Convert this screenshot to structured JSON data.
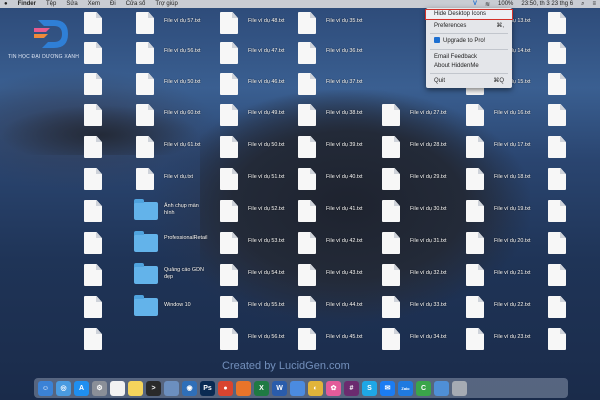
{
  "menubar": {
    "apple": "",
    "items": [
      "Finder",
      "Tệp",
      "Sửa",
      "Xem",
      "Đi",
      "Cửa sổ",
      "Trợ giúp"
    ],
    "status_percent": "100%",
    "clock": "23:50, th 3 23 thg 6"
  },
  "logo": {
    "text": "TIN HỌC ĐẠI DƯƠNG XANH"
  },
  "dropdown": {
    "items": [
      {
        "label": "Hide Desktop Icons",
        "shortcut": ""
      },
      {
        "label": "Preferences",
        "shortcut": "⌘,"
      },
      {
        "label": "Upgrade to Pro!",
        "shortcut": ""
      },
      {
        "label": "Email Feedback",
        "shortcut": ""
      },
      {
        "label": "About HiddenMe",
        "shortcut": ""
      },
      {
        "label": "Quit",
        "shortcut": "⌘Q"
      }
    ]
  },
  "desktop": {
    "columns": [
      {
        "items": [
          {
            "label": "",
            "kind": "file"
          },
          {
            "label": "",
            "kind": "file"
          },
          {
            "label": "",
            "kind": "file"
          },
          {
            "label": "",
            "kind": "file"
          },
          {
            "label": "",
            "kind": "file"
          },
          {
            "label": "",
            "kind": "file"
          },
          {
            "label": "",
            "kind": "file"
          },
          {
            "label": "",
            "kind": "file"
          },
          {
            "label": "",
            "kind": "file"
          },
          {
            "label": "",
            "kind": "file"
          },
          {
            "label": "",
            "kind": "file"
          }
        ]
      },
      {
        "items": [
          {
            "label": "File ví dụ 57.txt",
            "kind": "file"
          },
          {
            "label": "File ví dụ 56.txt",
            "kind": "file"
          },
          {
            "label": "File ví dụ 50.txt",
            "kind": "file"
          },
          {
            "label": "File ví dụ 60.txt",
            "kind": "file"
          },
          {
            "label": "File ví dụ 61.txt",
            "kind": "file"
          },
          {
            "label": "File ví dụ.txt",
            "kind": "file"
          },
          {
            "label": "Ảnh chụp màn hình",
            "kind": "folder"
          },
          {
            "label": "ProfessionalRetail",
            "kind": "folder"
          },
          {
            "label": "Quảng cáo GDN đẹp",
            "kind": "folder"
          },
          {
            "label": "Window 10",
            "kind": "folder"
          }
        ]
      },
      {
        "items": [
          {
            "label": "File ví dụ 48.txt",
            "kind": "file"
          },
          {
            "label": "File ví dụ 47.txt",
            "kind": "file"
          },
          {
            "label": "File ví dụ 46.txt",
            "kind": "file"
          },
          {
            "label": "File ví dụ 49.txt",
            "kind": "file"
          },
          {
            "label": "File ví dụ 50.txt",
            "kind": "file"
          },
          {
            "label": "File ví dụ 51.txt",
            "kind": "file"
          },
          {
            "label": "File ví dụ 52.txt",
            "kind": "file"
          },
          {
            "label": "File ví dụ 53.txt",
            "kind": "file"
          },
          {
            "label": "File ví dụ 54.txt",
            "kind": "file"
          },
          {
            "label": "File ví dụ 55.txt",
            "kind": "file"
          },
          {
            "label": "File ví dụ 56.txt",
            "kind": "file"
          }
        ]
      },
      {
        "items": [
          {
            "label": "File ví dụ 35.txt",
            "kind": "file"
          },
          {
            "label": "File ví dụ 36.txt",
            "kind": "file"
          },
          {
            "label": "File ví dụ 37.txt",
            "kind": "file"
          },
          {
            "label": "File ví dụ 38.txt",
            "kind": "file"
          },
          {
            "label": "File ví dụ 39.txt",
            "kind": "file"
          },
          {
            "label": "File ví dụ 40.txt",
            "kind": "file"
          },
          {
            "label": "File ví dụ 41.txt",
            "kind": "file"
          },
          {
            "label": "File ví dụ 42.txt",
            "kind": "file"
          },
          {
            "label": "File ví dụ 43.txt",
            "kind": "file"
          },
          {
            "label": "File ví dụ 44.txt",
            "kind": "file"
          },
          {
            "label": "File ví dụ 45.txt",
            "kind": "file"
          }
        ]
      },
      {
        "items": [
          {
            "label": "",
            "kind": "hidden"
          },
          {
            "label": "",
            "kind": "hidden"
          },
          {
            "label": "",
            "kind": "hidden"
          },
          {
            "label": "File ví dụ 27.txt",
            "kind": "file"
          },
          {
            "label": "File ví dụ 28.txt",
            "kind": "file"
          },
          {
            "label": "File ví dụ 29.txt",
            "kind": "file"
          },
          {
            "label": "File ví dụ 30.txt",
            "kind": "file"
          },
          {
            "label": "File ví dụ 31.txt",
            "kind": "file"
          },
          {
            "label": "File ví dụ 32.txt",
            "kind": "file"
          },
          {
            "label": "File ví dụ 33.txt",
            "kind": "file"
          },
          {
            "label": "File ví dụ 34.txt",
            "kind": "file"
          }
        ]
      },
      {
        "items": [
          {
            "label": "File ví dụ 13.txt",
            "kind": "file"
          },
          {
            "label": "File ví dụ 14.txt",
            "kind": "file"
          },
          {
            "label": "File ví dụ 15.txt",
            "kind": "file"
          },
          {
            "label": "File ví dụ 16.txt",
            "kind": "file"
          },
          {
            "label": "File ví dụ 17.txt",
            "kind": "file"
          },
          {
            "label": "File ví dụ 18.txt",
            "kind": "file"
          },
          {
            "label": "File ví dụ 19.txt",
            "kind": "file"
          },
          {
            "label": "File ví dụ 20.txt",
            "kind": "file"
          },
          {
            "label": "File ví dụ 21.txt",
            "kind": "file"
          },
          {
            "label": "File ví dụ 22.txt",
            "kind": "file"
          },
          {
            "label": "File ví dụ 23.txt",
            "kind": "file"
          }
        ]
      },
      {
        "items": [
          {
            "label": "",
            "kind": "file"
          },
          {
            "label": "",
            "kind": "file"
          },
          {
            "label": "",
            "kind": "file"
          },
          {
            "label": "",
            "kind": "file"
          },
          {
            "label": "",
            "kind": "file"
          },
          {
            "label": "",
            "kind": "file"
          },
          {
            "label": "",
            "kind": "file"
          },
          {
            "label": "",
            "kind": "file"
          },
          {
            "label": "",
            "kind": "file"
          },
          {
            "label": "",
            "kind": "file"
          },
          {
            "label": "",
            "kind": "file"
          }
        ]
      }
    ]
  },
  "watermark": "Created by LucidGen.com",
  "dock": {
    "apps": [
      {
        "name": "finder",
        "color": "#3b82d6",
        "glyph": "☺"
      },
      {
        "name": "safari",
        "color": "#4a9be0",
        "glyph": "◎"
      },
      {
        "name": "app-store",
        "color": "#1f8ff0",
        "glyph": "A"
      },
      {
        "name": "system-preferences",
        "color": "#8a8f98",
        "glyph": "⚙"
      },
      {
        "name": "calendar",
        "color": "#f2f2f2",
        "glyph": ""
      },
      {
        "name": "notes",
        "color": "#f4d45c",
        "glyph": ""
      },
      {
        "name": "terminal",
        "color": "#2a2a2a",
        "glyph": ">"
      },
      {
        "name": "preview",
        "color": "#6c8fbf",
        "glyph": ""
      },
      {
        "name": "migration",
        "color": "#2f6fb8",
        "glyph": "◉"
      },
      {
        "name": "photoshop",
        "color": "#0a2a52",
        "glyph": "Ps"
      },
      {
        "name": "screen-recorder",
        "color": "#d9442f",
        "glyph": "●"
      },
      {
        "name": "office",
        "color": "#e8742a",
        "glyph": ""
      },
      {
        "name": "excel",
        "color": "#1f7a43",
        "glyph": "X"
      },
      {
        "name": "word",
        "color": "#2a5cab",
        "glyph": "W"
      },
      {
        "name": "xcode",
        "color": "#4b8be0",
        "glyph": ""
      },
      {
        "name": "chrome",
        "color": "#e0b43a",
        "glyph": "◐"
      },
      {
        "name": "photos",
        "color": "#e35b9a",
        "glyph": "✿"
      },
      {
        "name": "slack",
        "color": "#6b2b6f",
        "glyph": "#"
      },
      {
        "name": "skype",
        "color": "#1ea7e6",
        "glyph": "S"
      },
      {
        "name": "messenger",
        "color": "#1b7cf2",
        "glyph": "✉"
      },
      {
        "name": "zalo",
        "color": "#1f7ae0",
        "glyph": "Zalo"
      },
      {
        "name": "camtasia",
        "color": "#3aa54a",
        "glyph": "C"
      },
      {
        "name": "finder-folder",
        "color": "#4f8fd6",
        "glyph": ""
      },
      {
        "name": "trash",
        "color": "#a6abb3",
        "glyph": ""
      }
    ]
  }
}
